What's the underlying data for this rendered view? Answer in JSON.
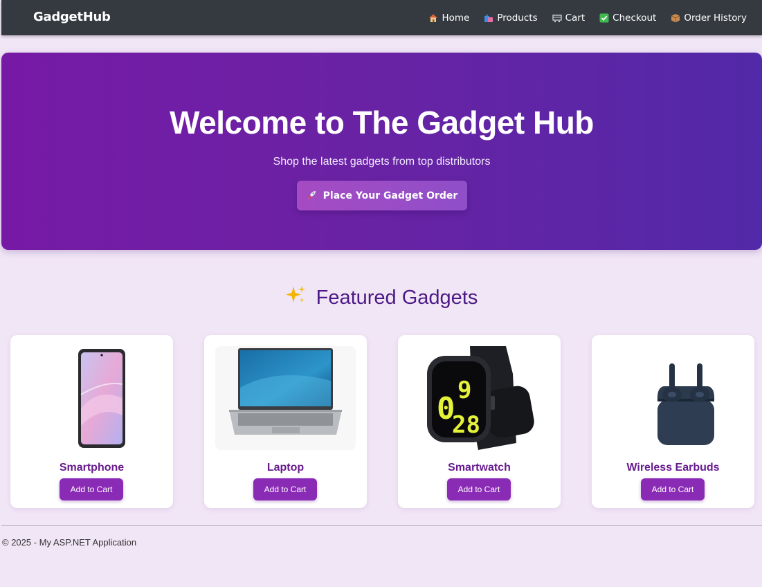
{
  "navbar": {
    "brand": "GadgetHub",
    "links": [
      {
        "label": "Home",
        "icon": "house-icon"
      },
      {
        "label": "Products",
        "icon": "shopping-bags-icon"
      },
      {
        "label": "Cart",
        "icon": "cart-icon"
      },
      {
        "label": "Checkout",
        "icon": "check-icon"
      },
      {
        "label": "Order History",
        "icon": "package-icon"
      }
    ]
  },
  "hero": {
    "title": "Welcome to The Gadget Hub",
    "subtitle": "Shop the latest gadgets from top distributors",
    "cta_label": "Place Your Gadget Order",
    "cta_icon": "rocket-icon"
  },
  "featured": {
    "title": "Featured Gadgets",
    "title_icon": "sparkles-icon",
    "products": [
      {
        "name": "Smartphone",
        "button": "Add to Cart"
      },
      {
        "name": "Laptop",
        "button": "Add to Cart"
      },
      {
        "name": "Smartwatch",
        "button": "Add to Cart"
      },
      {
        "name": "Wireless Earbuds",
        "button": "Add to Cart"
      }
    ]
  },
  "footer": {
    "text": "© 2025 - My ASP.NET Application"
  },
  "colors": {
    "navbar": "#343a40",
    "hero_start": "#761aa6",
    "hero_end": "#5229a8",
    "accent": "#8a2bb5",
    "heading": "#4c1a86",
    "page_bg": "#f1e6f6"
  }
}
